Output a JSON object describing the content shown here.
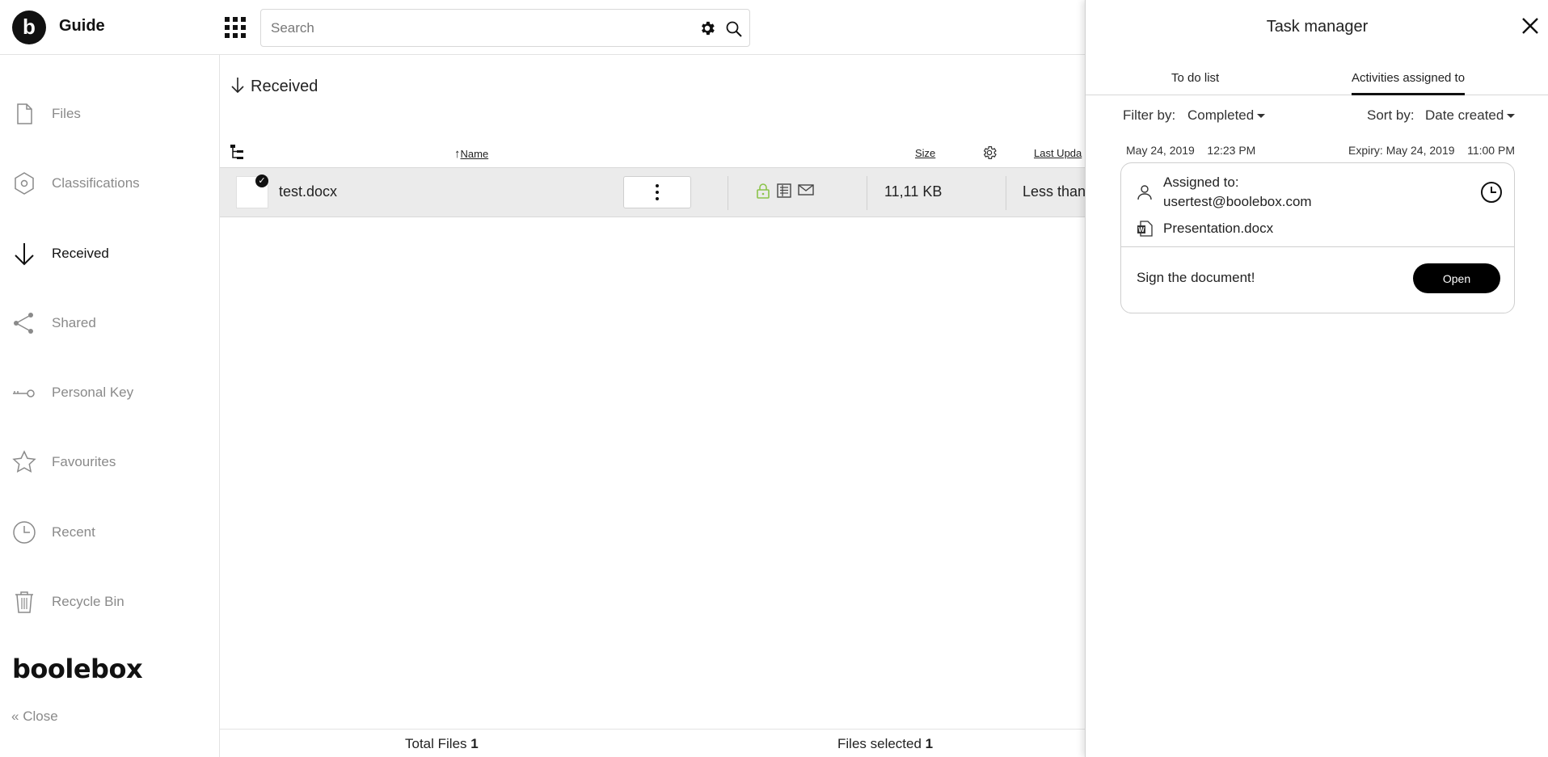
{
  "header": {
    "logo_letter": "b",
    "app_title": "Guide",
    "search_placeholder": "Search"
  },
  "sidebar": {
    "items": [
      {
        "label": "Files",
        "icon": "file-icon"
      },
      {
        "label": "Classifications",
        "icon": "hexagon-icon"
      },
      {
        "label": "Received",
        "icon": "arrow-down-icon",
        "active": true
      },
      {
        "label": "Shared",
        "icon": "share-icon"
      },
      {
        "label": "Personal Key",
        "icon": "key-icon"
      },
      {
        "label": "Favourites",
        "icon": "star-icon"
      },
      {
        "label": "Recent",
        "icon": "clock-icon"
      },
      {
        "label": "Recycle Bin",
        "icon": "trash-icon"
      }
    ],
    "brand": "boolebox",
    "close_label": "Close"
  },
  "main": {
    "heading": "Received",
    "columns": {
      "name": "Name",
      "size": "Size",
      "last_updated": "Last Upda"
    },
    "rows": [
      {
        "name": "test.docx",
        "size": "11,11 KB",
        "last_updated": "Less than"
      }
    ],
    "footer": {
      "total_label": "Total Files",
      "total_value": "1",
      "selected_label": "Files selected",
      "selected_value": "1"
    }
  },
  "task_manager": {
    "title": "Task manager",
    "tabs": [
      {
        "label": "To do list",
        "active": false
      },
      {
        "label": "Activities assigned to",
        "active": true
      }
    ],
    "filter_label": "Filter by:",
    "filter_value": "Completed",
    "sort_label": "Sort by:",
    "sort_value": "Date created",
    "task": {
      "created_date": "May 24, 2019",
      "created_time": "12:23 PM",
      "expiry_label": "Expiry:",
      "expiry_date": "May 24, 2019",
      "expiry_time": "11:00 PM",
      "assigned_label": "Assigned to:",
      "assigned_email": "usertest@boolebox.com",
      "document_name": "Presentation.docx",
      "message": "Sign the document!",
      "open_label": "Open"
    }
  },
  "colors": {
    "accent": "#000000",
    "lock_green": "#8bc34a",
    "row_selected": "#ebebeb",
    "inactive_text": "#8a8a8a"
  }
}
